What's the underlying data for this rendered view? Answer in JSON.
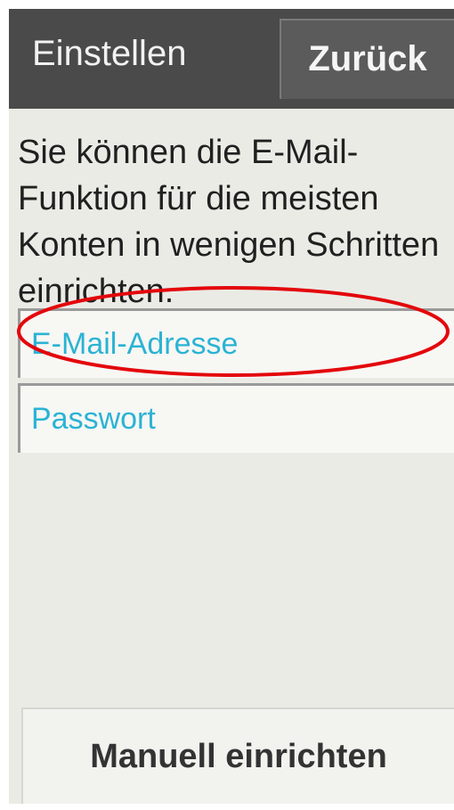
{
  "header": {
    "title": "Einstellen",
    "back_label": "Zurück"
  },
  "intro": {
    "text": "Sie können die E-Mail-Funktion für die meisten Konten in wenigen Schritten einrichten."
  },
  "form": {
    "email": {
      "placeholder": "E-Mail-Adresse",
      "value": ""
    },
    "password": {
      "placeholder": "Passwort",
      "value": ""
    }
  },
  "footer": {
    "manual_setup_label": "Manuell einrichten"
  },
  "colors": {
    "header_bg": "#4a4a4a",
    "accent": "#2bb3d4",
    "highlight": "#e3070b",
    "screen_bg": "#ebebe6"
  }
}
